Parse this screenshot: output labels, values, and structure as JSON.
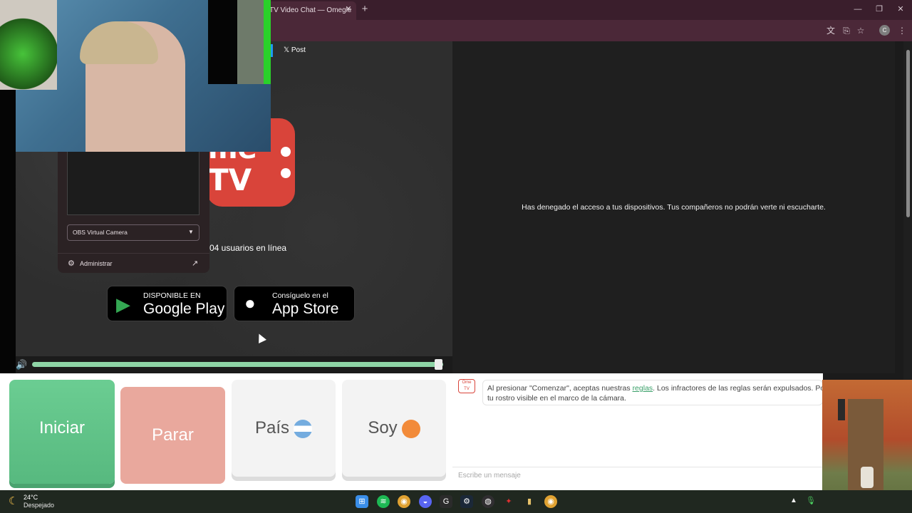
{
  "browser": {
    "tab_title": "TV Video Chat — Omegle",
    "tab_close": "✕",
    "new_tab": "+",
    "window_controls": {
      "minimize": "—",
      "restore": "❐",
      "close": "✕"
    },
    "profile_initial": "C",
    "toolbar_icons": [
      "translate-icon",
      "cast-icon",
      "star-icon",
      "menu-icon"
    ]
  },
  "page": {
    "x_post_label": "Post",
    "logo_top": "me",
    "logo_bottom": "TV",
    "users_online": "04 usuarios en línea",
    "denied_message": "Has denegado el acceso a tus dispositivos. Tus compañeros no podrán verte ni escucharte.",
    "google_play": {
      "small": "DISPONIBLE EN",
      "big": "Google Play"
    },
    "app_store": {
      "small": "Consíguelo en el",
      "big": "App Store"
    }
  },
  "camera_popup": {
    "selected_camera": "OBS Virtual Camera",
    "manage_label": "Administrar"
  },
  "volume": {
    "level": 0.99
  },
  "controls": {
    "start": "Iniciar",
    "stop": "Parar",
    "country": "País",
    "gender": "Soy"
  },
  "chat": {
    "logo_text": "Ome TV",
    "notice_prefix": "Al presionar \"Comenzar\", aceptas nuestras ",
    "notice_link": "reglas",
    "notice_suffix": ". Los infractores de las reglas serán expulsados. Por favor",
    "notice_line2": "tu rostro visible en el marco de la cámara.",
    "input_placeholder": "Escribe un mensaje"
  },
  "taskbar": {
    "temperature": "24°C",
    "weather": "Despejado",
    "apps": [
      "windows-start-icon",
      "spotify-icon",
      "chrome-icon",
      "discord-icon",
      "g-app-icon",
      "steam-icon",
      "obs-icon",
      "red-app-icon",
      "bottle-app-icon",
      "chrome-active-icon"
    ]
  },
  "colors": {
    "accent_green": "#6bcd92",
    "stop_red": "#e9a89d",
    "logo_red": "#d9443a"
  }
}
